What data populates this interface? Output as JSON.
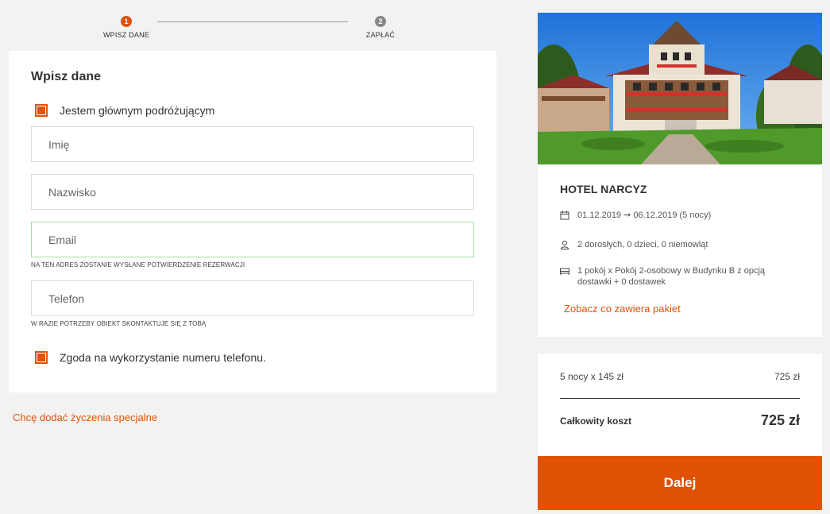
{
  "stepper": {
    "steps": [
      {
        "number": "1",
        "label": "WPISZ DANE"
      },
      {
        "number": "2",
        "label": "ZAPŁAĆ"
      }
    ]
  },
  "form": {
    "title": "Wpisz dane",
    "main_traveler_label": "Jestem głównym podróżującym",
    "first_name_placeholder": "Imię",
    "last_name_placeholder": "Nazwisko",
    "email_placeholder": "Email",
    "email_hint": "NA TEN ADRES ZOSTANIE WYSŁANE POTWIERDZENIE REZERWACJI",
    "phone_placeholder": "Telefon",
    "phone_hint": "W RAZIE POTRZEBY OBIEKT SKONTAKTUJE SIĘ Z TOBĄ",
    "phone_consent_label": "Zgoda na wykorzystanie numeru telefonu."
  },
  "special_requests_link": "Chcę dodać życzenia specjalne",
  "hotel": {
    "name": "HOTEL NARCYZ",
    "dates": "01.12.2019 ➞ 06.12.2019 (5 nocy)",
    "guests": "2 dorosłych, 0 dzieci, 0 niemowląt",
    "room": "1 pokój x Pokój 2-osobowy w Budynku B z opcją dostawki + 0 dostawek",
    "package_link": "Zobacz co zawiera pakiet"
  },
  "price": {
    "nights_label": "5 nocy x 145 zł",
    "nights_value": "725 zł",
    "total_label": "Całkowity koszt",
    "total_value": "725 zł"
  },
  "next_button": "Dalej",
  "colors": {
    "accent": "#e05206",
    "focus_border": "#9ee29e",
    "background": "#f2f2f2"
  }
}
